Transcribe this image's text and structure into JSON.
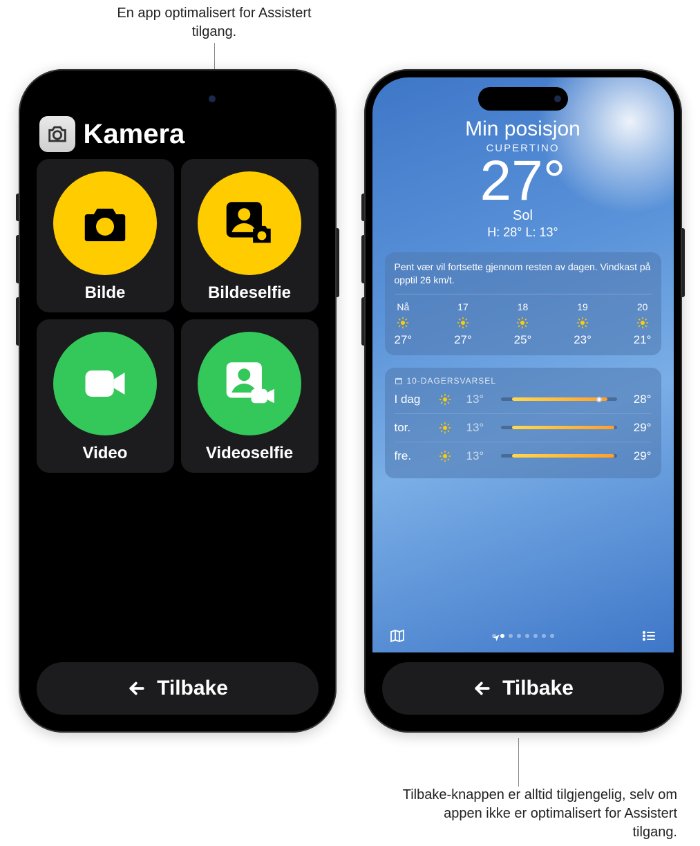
{
  "callouts": {
    "top": "En app optimalisert for Assistert tilgang.",
    "bottom": "Tilbake-knappen er alltid tilgjengelig, selv om appen ikke er optimalisert for Assistert tilgang."
  },
  "camera": {
    "title": "Kamera",
    "tiles": [
      {
        "id": "photo",
        "label": "Bilde",
        "color": "yellow",
        "icon": "camera-icon"
      },
      {
        "id": "photo-selfie",
        "label": "Bildeselfie",
        "color": "yellow",
        "icon": "person-camera-icon"
      },
      {
        "id": "video",
        "label": "Video",
        "color": "green",
        "icon": "video-icon"
      },
      {
        "id": "video-selfie",
        "label": "Videoselfie",
        "color": "green",
        "icon": "person-video-icon"
      }
    ],
    "back_label": "Tilbake"
  },
  "weather": {
    "location_title": "Min posisjon",
    "city": "CUPERTINO",
    "temp": "27°",
    "condition": "Sol",
    "hilo": "H: 28° L: 13°",
    "summary": "Pent vær vil fortsette gjennom resten av dagen. Vindkast på opptil 26 km/t.",
    "hourly": [
      {
        "label": "Nå",
        "temp": "27°"
      },
      {
        "label": "17",
        "temp": "27°"
      },
      {
        "label": "18",
        "temp": "25°"
      },
      {
        "label": "19",
        "temp": "23°"
      },
      {
        "label": "20",
        "temp": "21°"
      }
    ],
    "ten_day_title": "10-DAGERSVARSEL",
    "forecast": [
      {
        "day": "I dag",
        "lo": "13°",
        "hi": "28°",
        "bar_start": 10,
        "bar_end": 92,
        "dot": 85
      },
      {
        "day": "tor.",
        "lo": "13°",
        "hi": "29°",
        "bar_start": 10,
        "bar_end": 98
      },
      {
        "day": "fre.",
        "lo": "13°",
        "hi": "29°",
        "bar_start": 10,
        "bar_end": 98
      }
    ],
    "back_label": "Tilbake"
  }
}
